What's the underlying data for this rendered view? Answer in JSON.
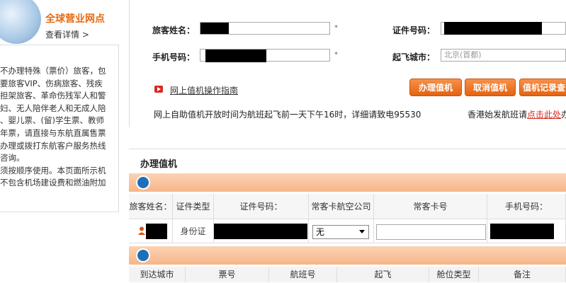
{
  "sidebar": {
    "promo_title": "全球营业网点",
    "promo_link": "查看详情 >",
    "notes": [
      "不办理特殊（票价）旅客，包",
      "要旅客VIP、伤病旅客、残疾",
      "担架旅客、革命伤残军人和警",
      "妇、无人陪伴老人和无成人陪",
      "、婴儿票、(留)学生票、教师",
      "年票，请直接与东航直属售票",
      "办理或拨打东航客户服务热线",
      "咨询。",
      "须按顺序使用。本页面所示机",
      "不包含机场建设费和燃油附加"
    ]
  },
  "form": {
    "passenger_name_label": "旅客姓名：",
    "id_number_label": "证件号码：",
    "mobile_label": "手机号码：",
    "departure_city_label": "起飞城市：",
    "departure_city_value": "北京(首都)",
    "required_mark": "*"
  },
  "guide": {
    "link_text": "网上值机操作指南"
  },
  "buttons": {
    "checkin": "办理值机",
    "cancel": "取消值机",
    "records": "值机记录查"
  },
  "notice": {
    "left": "网上自助值机开放时间为航班起飞前一天下午16时，详细请致电95530",
    "right_prefix": "香港始发航班请",
    "right_link": "点击此处",
    "right_suffix": "办"
  },
  "checkin_section": {
    "title": "办理值机",
    "columns": [
      "旅客姓名：",
      "证件类型",
      "证件号码：",
      "常客卡航空公司",
      "常客卡号",
      "手机号码："
    ],
    "row": {
      "id_type": "身份证",
      "ff_airline": "无"
    },
    "flight_columns": [
      "到达城市",
      "票号",
      "航班号",
      "起飞",
      "舱位类型",
      "备注"
    ]
  },
  "colors": {
    "accent_orange": "#e86a10",
    "button_orange": "#e4630f",
    "section_bar": "#f7b58a",
    "link_red": "#d62b20"
  }
}
